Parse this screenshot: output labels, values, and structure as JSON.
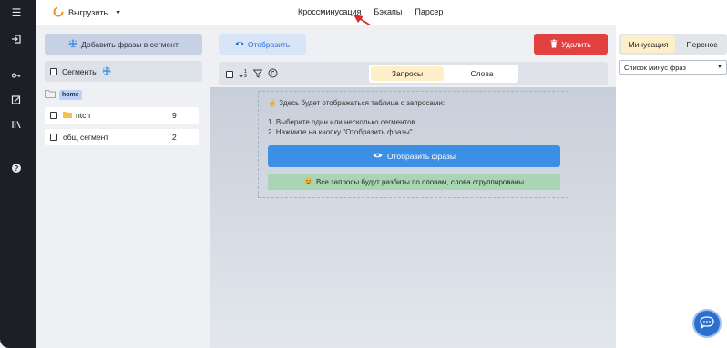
{
  "topbar": {
    "export_label": "Выгрузить",
    "nav": [
      "Кроссминусация",
      "Бэкапы",
      "Парсер"
    ]
  },
  "left": {
    "add_button": "Добавить фразы в сегмент",
    "segments_header": "Сегменты",
    "home_tag": "home",
    "segments": [
      {
        "name": "ntcn",
        "count": "9"
      },
      {
        "name": "общ сегмент",
        "count": "2"
      }
    ]
  },
  "center": {
    "show_button": "Отобразить",
    "delete_button": "Удалить",
    "tabs": [
      "Запросы",
      "Слова"
    ],
    "hint_title": "Здесь будет отображаться таблица с запросами:",
    "hint_step1": "1. Выберите один или несколько сегментов",
    "hint_step2": "2. Нажмите на кнопку \"Отобразить фразы\"",
    "show_phrases_button": "Отобразить фразы",
    "info_banner": "Все запросы будут разбиты по словам, слова сгруппированы"
  },
  "right": {
    "tabs": [
      "Минусация",
      "Перенос"
    ],
    "select_value": "Список минус фраз"
  },
  "colors": {
    "sidebar": "#1c1f26",
    "primary": "#3b8fe4",
    "danger": "#e2423f",
    "active_tab": "#fdf0c8",
    "success_banner": "#a9d5b4",
    "annotation_arrow": "#d92b2b"
  },
  "icons": [
    "menu-icon",
    "login-icon",
    "key-icon",
    "edit-icon",
    "library-icon",
    "help-icon",
    "export-logo-icon",
    "plus-icon",
    "folder-icon",
    "eye-icon",
    "trash-icon",
    "sort-icon",
    "filter-icon",
    "copyright-icon",
    "chat-icon"
  ]
}
